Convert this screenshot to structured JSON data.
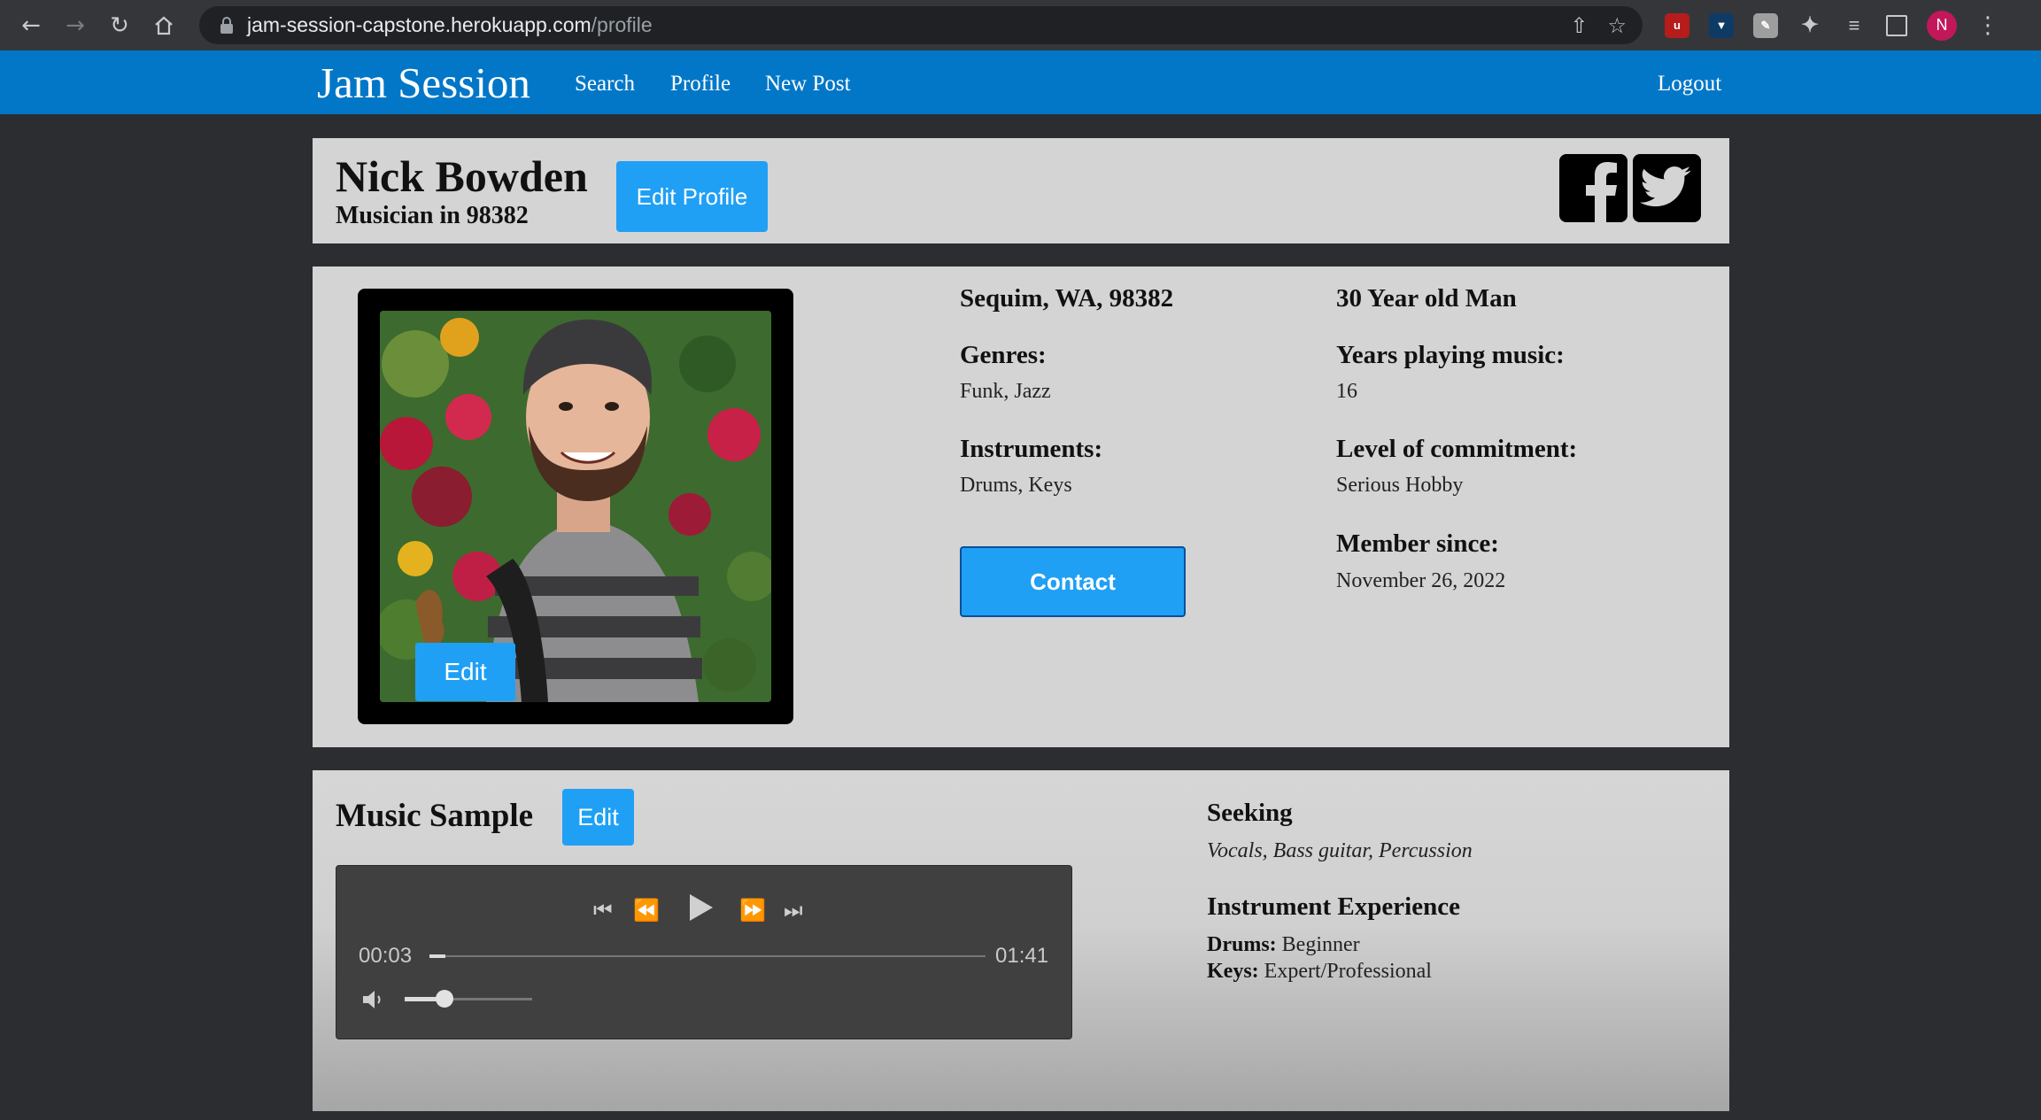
{
  "browser": {
    "url_host": "jam-session-capstone.herokuapp.com",
    "url_path": "/profile",
    "profile_initial": "N"
  },
  "nav": {
    "brand": "Jam Session",
    "links": [
      "Search",
      "Profile",
      "New Post"
    ],
    "logout": "Logout"
  },
  "profile": {
    "name": "Nick Bowden",
    "subtitle": "Musician in 98382",
    "edit_profile_label": "Edit Profile",
    "photo_edit_label": "Edit",
    "location": "Sequim, WA, 98382",
    "age_gender": "30 Year old Man",
    "genres_label": "Genres:",
    "genres": "Funk, Jazz",
    "instruments_label": "Instruments:",
    "instruments": "Drums, Keys",
    "years_label": "Years playing music:",
    "years": "16",
    "commitment_label": "Level of commitment:",
    "commitment": "Serious Hobby",
    "member_label": "Member since:",
    "member_since": "November 26, 2022",
    "contact_label": "Contact"
  },
  "music": {
    "title": "Music Sample",
    "edit_label": "Edit",
    "current_time": "00:03",
    "duration": "01:41",
    "progress_fraction": 0.03,
    "volume_fraction": 0.3
  },
  "seeking": {
    "title": "Seeking",
    "value": "Vocals, Bass guitar, Percussion",
    "experience_title": "Instrument Experience",
    "experience": [
      {
        "instrument": "Drums:",
        "level": "Beginner"
      },
      {
        "instrument": "Keys:",
        "level": "Expert/Professional"
      }
    ]
  },
  "colors": {
    "nav_blue": "#0277c7",
    "button_blue": "#1fa0f5",
    "panel_gray": "#d4d4d4",
    "background": "#2c2d30"
  },
  "icons": [
    "back-icon",
    "forward-icon",
    "reload-icon",
    "home-icon",
    "lock-icon",
    "share-icon",
    "star-icon",
    "puzzle-icon",
    "facebook-icon",
    "twitter-icon",
    "play-icon",
    "volume-icon"
  ]
}
